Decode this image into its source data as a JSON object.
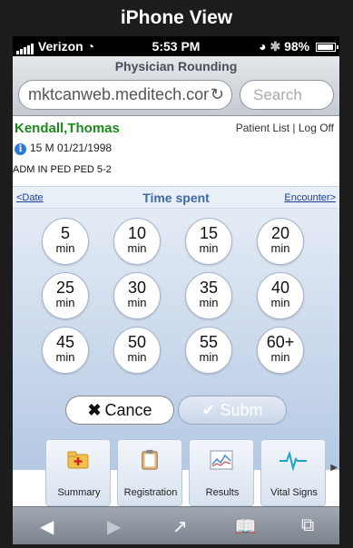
{
  "view_title": "iPhone View",
  "status_bar": {
    "carrier": "Verizon",
    "time": "5:53 PM",
    "battery": "98%"
  },
  "browser": {
    "page_title": "Physician Rounding",
    "url": "mktcanweb.meditech.com",
    "search_placeholder": "Search"
  },
  "patient": {
    "name": "Kendall,Thomas",
    "links": "Patient List  |  Log Off",
    "details": "15 M 01/21/1998",
    "admission": "ADM IN PED PED 5-2"
  },
  "nav": {
    "prev": "<Date",
    "title": "Time spent",
    "next": "Encounter>"
  },
  "time_options": [
    {
      "value": "5",
      "unit": "min"
    },
    {
      "value": "10",
      "unit": "min"
    },
    {
      "value": "15",
      "unit": "min"
    },
    {
      "value": "20",
      "unit": "min"
    },
    {
      "value": "25",
      "unit": "min"
    },
    {
      "value": "30",
      "unit": "min"
    },
    {
      "value": "35",
      "unit": "min"
    },
    {
      "value": "40",
      "unit": "min"
    },
    {
      "value": "45",
      "unit": "min"
    },
    {
      "value": "50",
      "unit": "min"
    },
    {
      "value": "55",
      "unit": "min"
    },
    {
      "value": "60+",
      "unit": "min"
    }
  ],
  "actions": {
    "cancel": "Cance",
    "submit": "Subm"
  },
  "tabs": [
    {
      "label": "Summary",
      "icon": "folder-plus-icon"
    },
    {
      "label": "Registration",
      "icon": "clipboard-icon"
    },
    {
      "label": "Results",
      "icon": "chart-icon"
    },
    {
      "label": "Vital Signs",
      "icon": "heartbeat-icon"
    }
  ],
  "colors": {
    "patient_name": "#1d8a1d",
    "link": "#1a3fa0",
    "title": "#3d6aa8",
    "info": "#2b79d6"
  }
}
